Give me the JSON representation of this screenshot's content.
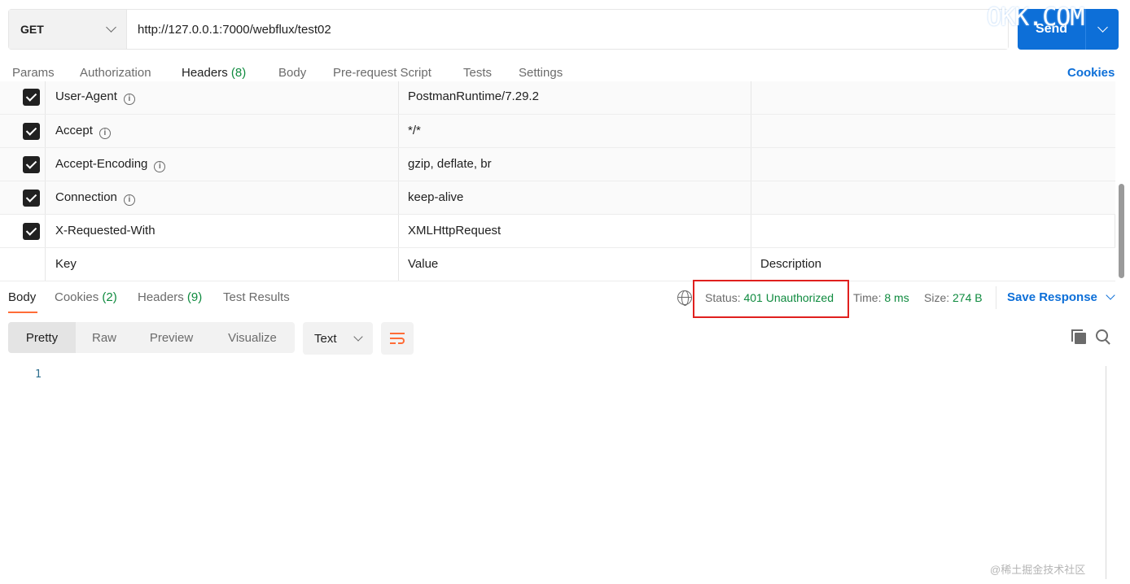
{
  "request": {
    "method": "GET",
    "url": "http://127.0.0.1:7000/webflux/test02",
    "send_label": "Send"
  },
  "watermark_text": "OKK.COM",
  "request_tabs": [
    {
      "label": "Params",
      "count": ""
    },
    {
      "label": "Authorization",
      "count": ""
    },
    {
      "label": "Headers",
      "count": "(8)"
    },
    {
      "label": "Body",
      "count": ""
    },
    {
      "label": "Pre-request Script",
      "count": ""
    },
    {
      "label": "Tests",
      "count": ""
    },
    {
      "label": "Settings",
      "count": ""
    }
  ],
  "cookies_link": "Cookies",
  "headers": [
    {
      "key": "User-Agent",
      "value": "PostmanRuntime/7.29.2",
      "checked": true
    },
    {
      "key": "Accept",
      "value": "*/*",
      "checked": true
    },
    {
      "key": "Accept-Encoding",
      "value": "gzip, deflate, br",
      "checked": true
    },
    {
      "key": "Connection",
      "value": "keep-alive",
      "checked": true
    },
    {
      "key": "X-Requested-With",
      "value": "XMLHttpRequest",
      "checked": true
    }
  ],
  "new_row": {
    "key": "Key",
    "value": "Value",
    "description": "Description"
  },
  "response_tabs": [
    {
      "label": "Body",
      "count": ""
    },
    {
      "label": "Cookies",
      "count": "(2)"
    },
    {
      "label": "Headers",
      "count": "(9)"
    },
    {
      "label": "Test Results",
      "count": ""
    }
  ],
  "response_meta": {
    "status_label": "Status:",
    "status_value": "401 Unauthorized",
    "time_label": "Time:",
    "time_value": "8 ms",
    "size_label": "Size:",
    "size_value": "274 B",
    "save_response": "Save Response"
  },
  "format_buttons": [
    "Pretty",
    "Raw",
    "Preview",
    "Visualize"
  ],
  "content_type": "Text",
  "editor": {
    "line_number": "1"
  },
  "footer_watermark": "@稀土掘金技术社区",
  "colors": {
    "accent_orange": "#ff6c37",
    "brand_blue": "#0d6fd8",
    "status_green": "#0e8a3e",
    "highlight_red": "#e0201e"
  }
}
